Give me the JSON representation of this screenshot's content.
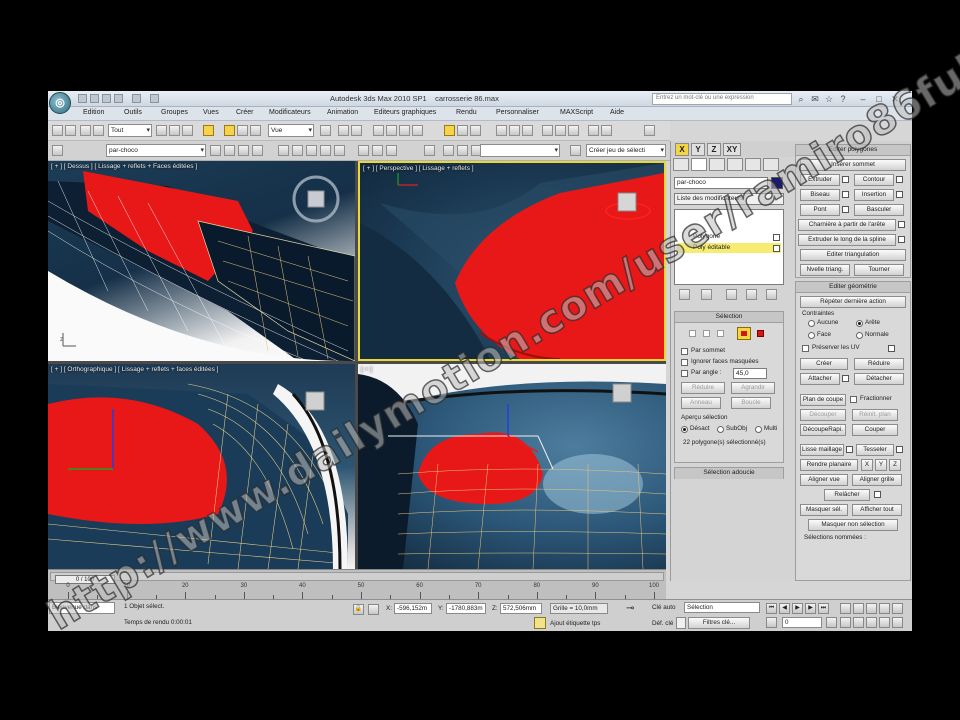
{
  "app": {
    "title": "Autodesk 3ds Max 2010 SP1",
    "file": "carrosserie 86.max",
    "search_placeholder": "Entrez un mot-clé ou une expression"
  },
  "menubar": [
    "Edition",
    "Outils",
    "Groupes",
    "Vues",
    "Créer",
    "Modificateurs",
    "Animation",
    "Editeurs graphiques",
    "Rendu",
    "Personnaliser",
    "MAXScript",
    "Aide"
  ],
  "toolbar1": {
    "filter": "Tout",
    "ref_coord": "Vue"
  },
  "toolbar2": {
    "layer": "par-choco",
    "named_sel": "Créer jeu de sélecti"
  },
  "viewports": {
    "top": "[ + ] [ Dessus ] [ Lissage + reflets + Faces éditées ]",
    "perspective": "[ + ] [ Perspective ] [ Lissage + reflets ]",
    "left": "[ + ] [ Orthographique ] [ Lissage + reflets + faces éditées ]",
    "camera": "[ + ]"
  },
  "panel": {
    "tabs": [
      "X",
      "Y",
      "Z",
      "XY"
    ],
    "object_name": "par-choco",
    "modifier_list": "Liste des modificateurs",
    "stack": [
      {
        "label": "Polygone",
        "selected": false
      },
      {
        "label": "Poly éditable",
        "selected": true
      }
    ],
    "selection": {
      "title": "Sélection",
      "by_vertex": "Par sommet",
      "ignore_backfacing": "Ignorer faces masquées",
      "by_angle": "Par angle :",
      "angle_value": "45,0",
      "shrink": "Réduire",
      "grow": "Agrandir",
      "ring": "Anneau",
      "loop": "Boucle",
      "preview": "Aperçu sélection",
      "off": "Désact",
      "subobj": "SubObj",
      "multi": "Multi",
      "status": "22 polygone(s) sélectionné(s)"
    },
    "soft_selection": "Sélection adoucie",
    "edit_polygons": {
      "title": "Editer polygones",
      "insert_vertex": "Insérer sommet",
      "extrude": "Extruder",
      "outline": "Contour",
      "bevel": "Biseau",
      "inset": "Insertion",
      "bridge": "Pont",
      "flip": "Basculer",
      "hinge": "Charnière à partir de l'arête",
      "extrude_spline": "Extruder le long de la spline",
      "edit_triang": "Editer triangulation",
      "retriangulate": "Nvelle triang.",
      "turn": "Tourner"
    },
    "edit_geometry": {
      "title": "Editer géométrie",
      "repeat": "Répéter dernière action",
      "constraints": "Contraintes",
      "none": "Aucune",
      "edge": "Arête",
      "face": "Face",
      "normal": "Normale",
      "preserve_uv": "Préserver les UV",
      "create": "Créer",
      "collapse": "Réduire",
      "attach": "Attacher",
      "detach": "Détacher",
      "slice_plane": "Plan de coupe",
      "split": "Fractionner",
      "slice": "Découper",
      "reset_plane": "Réinit. plan",
      "quickslice": "DécoupeRapi.",
      "cut": "Couper",
      "msmooth": "Lisse maillage",
      "tessellate": "Tesseler",
      "make_planar": "Rendre planaire",
      "view_align": "Aligner vue",
      "grid_align": "Aligner grille",
      "relax": "Relâcher",
      "hide_sel": "Masquer sél.",
      "unhide_all": "Afficher tout",
      "hide_unsel": "Masquer non sélection",
      "named_sel": "Sélections nommées :"
    }
  },
  "timeline": {
    "thumb": "0 / 100",
    "ticks": [
      0,
      10,
      20,
      30,
      40,
      50,
      60,
      70,
      80,
      90,
      100
    ]
  },
  "status": {
    "listener": "Bienvenue dans",
    "selected": "1 Objet sélect.",
    "render_time": "Temps de rendu 0:00:01",
    "x_label": "X:",
    "x_value": "-596,152m",
    "y_label": "Y:",
    "y_value": "-1780,883m",
    "z_label": "Z:",
    "z_value": "572,506mm",
    "grid": "Grille = 10,0mm",
    "add_key": "Ajout étiquette tps",
    "auto_key": "Clé auto",
    "set_key": "Déf. clé",
    "selection_mode": "Sélection",
    "key_filters": "Filtres clé...",
    "frame": "0"
  },
  "watermark": "http://www.dailymotion.com/user/ramiro86full/1",
  "colors": {
    "accent": "#f4d544",
    "viewport_bg": "#1c3548",
    "car_red": "#e81818"
  }
}
